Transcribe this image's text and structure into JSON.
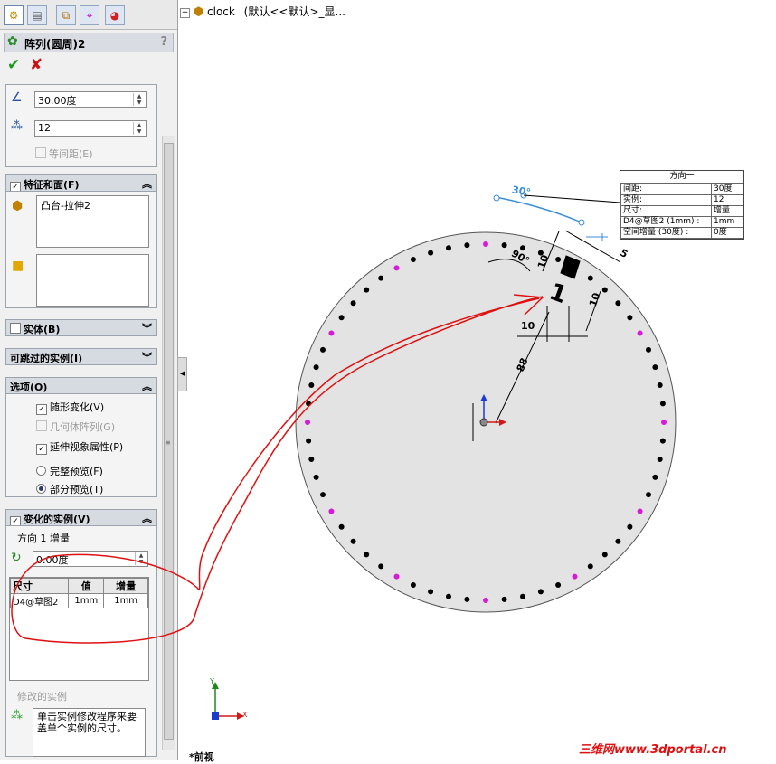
{
  "tree_header": {
    "model_name": "clock",
    "config_text": "(默认<<默认>_显..."
  },
  "tabs": [
    {
      "icon": "feature-manager-icon"
    },
    {
      "icon": "property-manager-icon"
    },
    {
      "icon": "configuration-manager-icon"
    },
    {
      "icon": "dimxpert-icon"
    },
    {
      "icon": "display-manager-icon"
    }
  ],
  "feature_title": "阵列(圆周)2",
  "help_label": "?",
  "direction": {
    "angle_value": "30.00度",
    "count_value": "12",
    "equal_spacing_label": "等间距(E)"
  },
  "features_faces": {
    "title": "特征和面(F)",
    "features": [
      "凸台-拉伸2"
    ]
  },
  "bodies": {
    "title": "实体(B)"
  },
  "skip_instances": {
    "title": "可跳过的实例(I)"
  },
  "options": {
    "title": "选项(O)",
    "geometry_pattern_follow": "随形变化(V)",
    "geometry_pattern": "几何体阵列(G)",
    "propagate_visual": "延伸视象属性(P)",
    "full_preview": "完整预览(F)",
    "partial_preview": "部分预览(T)"
  },
  "varying_instances": {
    "title": "变化的实例(V)",
    "increment_label": "方向 1 增量",
    "increment_value": "0.00度",
    "table": {
      "headers": [
        "尺寸",
        "值",
        "增量"
      ],
      "rows": [
        {
          "dimension": "D4@草图2",
          "value": "1mm",
          "increment": "1mm"
        }
      ]
    },
    "modified_label": "修改的实例",
    "hint_text": "单击实例修改程序来要盖单个实例的尺寸。"
  },
  "callout": {
    "title": "方向一",
    "rows": [
      {
        "label": "间距:",
        "value": "30度"
      },
      {
        "label": "实例:",
        "value": "12"
      },
      {
        "label": "尺寸:",
        "value": "增量"
      },
      {
        "label": "D4@草图2 (1mm) :",
        "value": "1mm"
      },
      {
        "label": "空间增量 (30度) :",
        "value": "0度"
      }
    ]
  },
  "dimensions": {
    "angle": "30°",
    "right_angle": "90°",
    "d10_top": "10",
    "d5": "5",
    "d10_right": "10",
    "d10_bottom": "10",
    "d88": "88",
    "digit": "1"
  },
  "triad": {
    "y": "Y",
    "x": "X"
  },
  "view_name": "*前视",
  "watermark": "三维网www.3dportal.cn",
  "colors": {
    "annotation_red": "#e01010",
    "dot_magenta": "#d81ad8",
    "dim_blue": "#3a8ddc",
    "sheet_gray": "#e3e3e3"
  }
}
